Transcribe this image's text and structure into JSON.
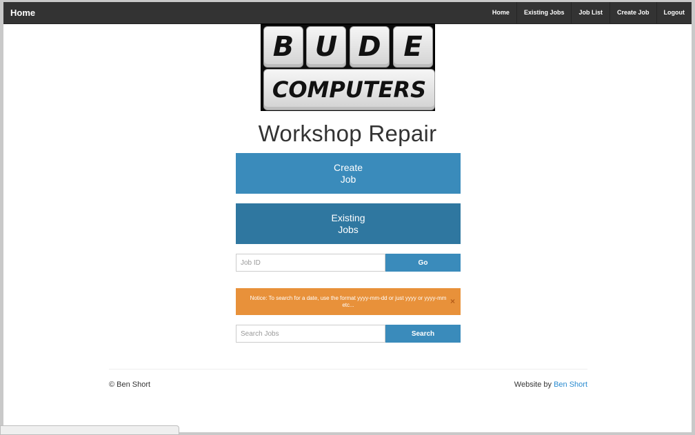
{
  "navbar": {
    "brand": "Home",
    "links": [
      "Home",
      "Existing Jobs",
      "Job List",
      "Create Job",
      "Logout"
    ]
  },
  "logo": {
    "letters": [
      "B",
      "U",
      "D",
      "E"
    ],
    "word": "COMPUTERS"
  },
  "title": "Workshop Repair",
  "buttons": {
    "create_job": "Create\nJob",
    "existing_jobs": "Existing\nJobs"
  },
  "job_id_form": {
    "placeholder": "Job ID",
    "button": "Go"
  },
  "notice": {
    "text": "Notice: To search for a date, use the format yyyy-mm-dd or just yyyy or yyyy-mm etc...",
    "close": "×"
  },
  "search_form": {
    "placeholder": "Search Jobs",
    "button": "Search"
  },
  "footer": {
    "copyright": "© Ben Short",
    "credit_prefix": "Website by ",
    "credit_link": "Ben Short"
  },
  "colors": {
    "navbar": "#333333",
    "primary": "#3a8bbb",
    "primary_dark": "#2f77a0",
    "notice": "#e8913a",
    "link": "#2a8bd0"
  }
}
